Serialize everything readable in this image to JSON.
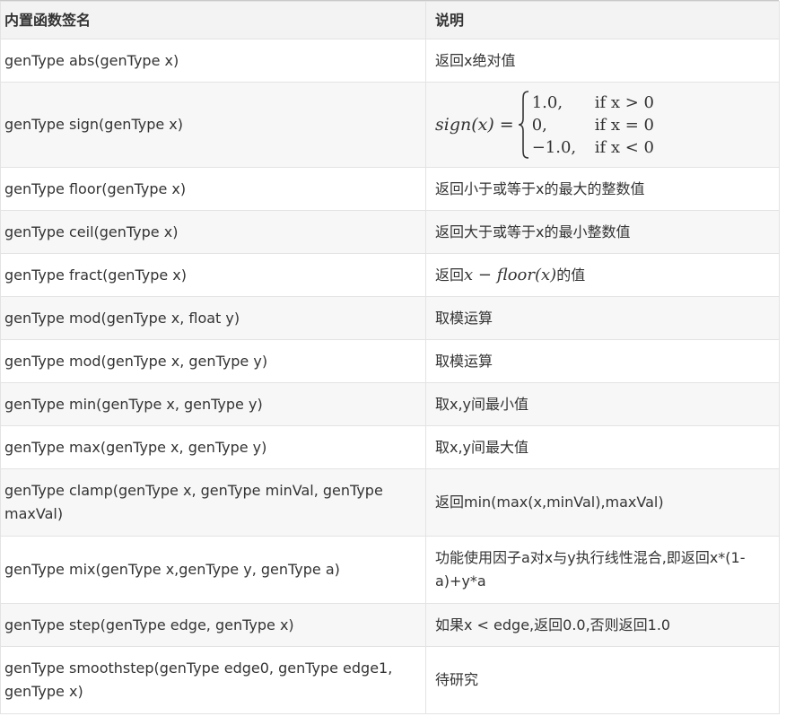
{
  "table": {
    "headers": [
      "内置函数签名",
      "说明"
    ],
    "rows": [
      {
        "sig": "genType abs(genType x)",
        "desc": "返回x绝对值"
      },
      {
        "sig": "genType sign(genType x)",
        "desc_math": {
          "lhs_fn": "sign",
          "lhs_arg": "(x)",
          "eq": "=",
          "cases": [
            {
              "value": "1.0,",
              "cond": "if x > 0"
            },
            {
              "value": "0,",
              "cond": "if x = 0"
            },
            {
              "value": "−1.0,",
              "cond": "if x < 0"
            }
          ]
        }
      },
      {
        "sig": "genType floor(genType x)",
        "desc": "返回小于或等于x的最大的整数值"
      },
      {
        "sig": "genType ceil(genType x)",
        "desc": "返回大于或等于x的最小整数值"
      },
      {
        "sig": "genType fract(genType x)",
        "desc_parts": {
          "pre": "返回",
          "math": "x − floor(x)",
          "post": "的值"
        }
      },
      {
        "sig": "genType mod(genType x, float y)",
        "desc": "取模运算"
      },
      {
        "sig": "genType mod(genType x, genType y)",
        "desc": "取模运算"
      },
      {
        "sig": "genType min(genType x, genType y)",
        "desc": "取x,y间最小值"
      },
      {
        "sig": "genType max(genType x, genType y)",
        "desc": "取x,y间最大值"
      },
      {
        "sig": "genType clamp(genType x, genType minVal, genType maxVal)",
        "desc": "返回min(max(x,minVal),maxVal)"
      },
      {
        "sig": "genType mix(genType x,genType y, genType a)",
        "desc": "功能使用因子a对x与y执行线性混合,即返回x*(1-a)+y*a"
      },
      {
        "sig": "genType step(genType edge, genType x)",
        "desc": "如果x < edge,返回0.0,否则返回1.0"
      },
      {
        "sig": "genType smoothstep(genType edge0, genType edge1, genType x)",
        "desc": "待研究"
      }
    ]
  }
}
